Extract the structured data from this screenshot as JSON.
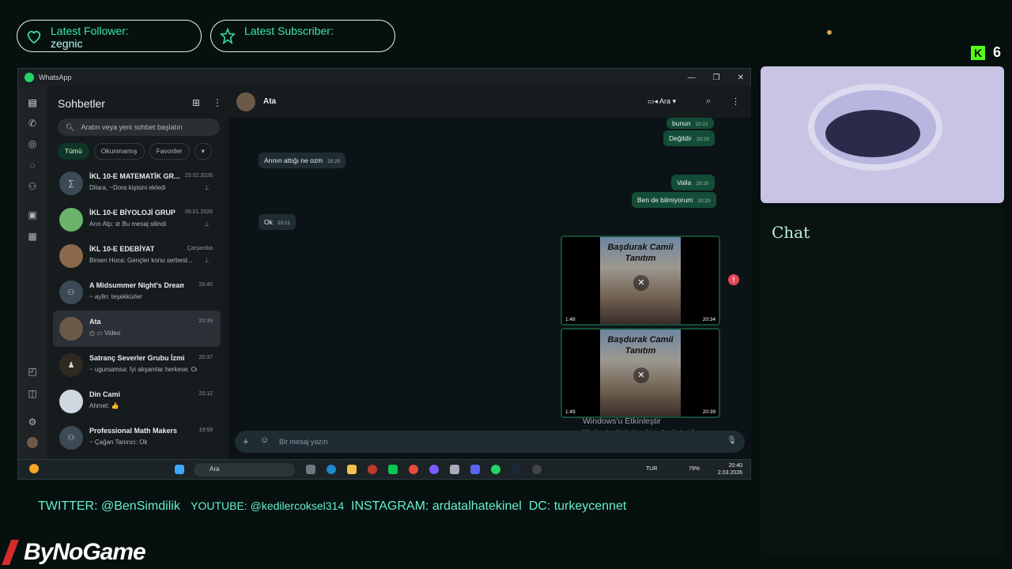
{
  "overlay": {
    "follower_label": "Latest Follower:",
    "follower_value": "zegnic",
    "subscriber_label": "Latest Subscriber:",
    "subscriber_value": "",
    "kick_count": "6",
    "chat_title": "Chat",
    "social_twitter": "TWITTER: @BenSimdilik",
    "social_youtube": "YOUTUBE: @kedilercoksel314",
    "social_instagram": "INSTAGRAM: ardatalhatekinel",
    "social_dc": "DC: turkeycennet",
    "brand": "ByNoGame"
  },
  "window": {
    "title": "WhatsApp"
  },
  "sidebar": {
    "title": "Sohbetler",
    "search_placeholder": "Aratın veya yeni sohbet başlatın",
    "filters": [
      "Tümü",
      "Okunmamış",
      "Favoriler"
    ],
    "chats": [
      {
        "name": "İKL 10-E MATEMATİK GR...",
        "time": "23.02.2026",
        "preview": "Dilara, ~Dora kişisini ekledi",
        "pinned": true
      },
      {
        "name": "İKL 10-E BİYOLOJİ GRUP",
        "time": "09.01.2026",
        "preview": "Arın Alp: ⊘ Bu mesaj silindi",
        "pinned": true
      },
      {
        "name": "İKL 10-E EDEBİYAT",
        "time": "Çarşamba",
        "preview": "Birsen Hoca: Gençler konu serbest...",
        "pinned": true
      },
      {
        "name": "A Midsummer Night's Dream",
        "time": "20:40",
        "preview": "~ aylin: teşekkürler",
        "pinned": false
      },
      {
        "name": "Ata",
        "time": "20:39",
        "preview": "Video",
        "pinned": false
      },
      {
        "name": "Satranç Severler Grubu İzmir",
        "time": "20:37",
        "preview": "~ ugursamsa: İyi akşamlar herkese. Oğ...",
        "pinned": false
      },
      {
        "name": "Din Cami",
        "time": "20:12",
        "preview": "Ahmet: 👍",
        "pinned": false
      },
      {
        "name": "Professional Math Makers",
        "time": "19:59",
        "preview": "~ Çağan Tanırıcı: Ok",
        "pinned": false
      }
    ]
  },
  "chat": {
    "contact": "Ata",
    "call_label": "Ara",
    "messages": [
      {
        "dir": "out",
        "text": "bunun",
        "time": "20:21"
      },
      {
        "dir": "out",
        "text": "Değildir",
        "time": "20:20"
      },
      {
        "dir": "in",
        "text": "Arının attığı ne ozm",
        "time": "20:20"
      },
      {
        "dir": "out",
        "text": "Valla",
        "time": "20:20"
      },
      {
        "dir": "out",
        "text": "Ben de bilmiyorum",
        "time": "20:20"
      },
      {
        "dir": "in",
        "text": "Ok",
        "time": "20:21"
      }
    ],
    "videos": [
      {
        "caption": "Başdurak Camii Tanıtım",
        "duration": "1:49",
        "time": "20:34"
      },
      {
        "caption": "Başdurak Camii Tanıtım",
        "duration": "1:49",
        "time": "20:39"
      }
    ],
    "compose_placeholder": "Bir mesaj yazın",
    "activation_title": "Windows'u Etkinleştir",
    "activation_sub": "Windows'u etkinleştirmek için Ayarlar'a gidin."
  },
  "taskbar": {
    "search_label": "Ara",
    "lang": "TUR",
    "battery": "79%",
    "time": "20:40",
    "date": "2.03.2026"
  },
  "colors": {
    "accent": "#3ee6a8",
    "wa_green": "#25d366",
    "bubble_out": "#144d37",
    "bubble_in": "#202c33"
  }
}
